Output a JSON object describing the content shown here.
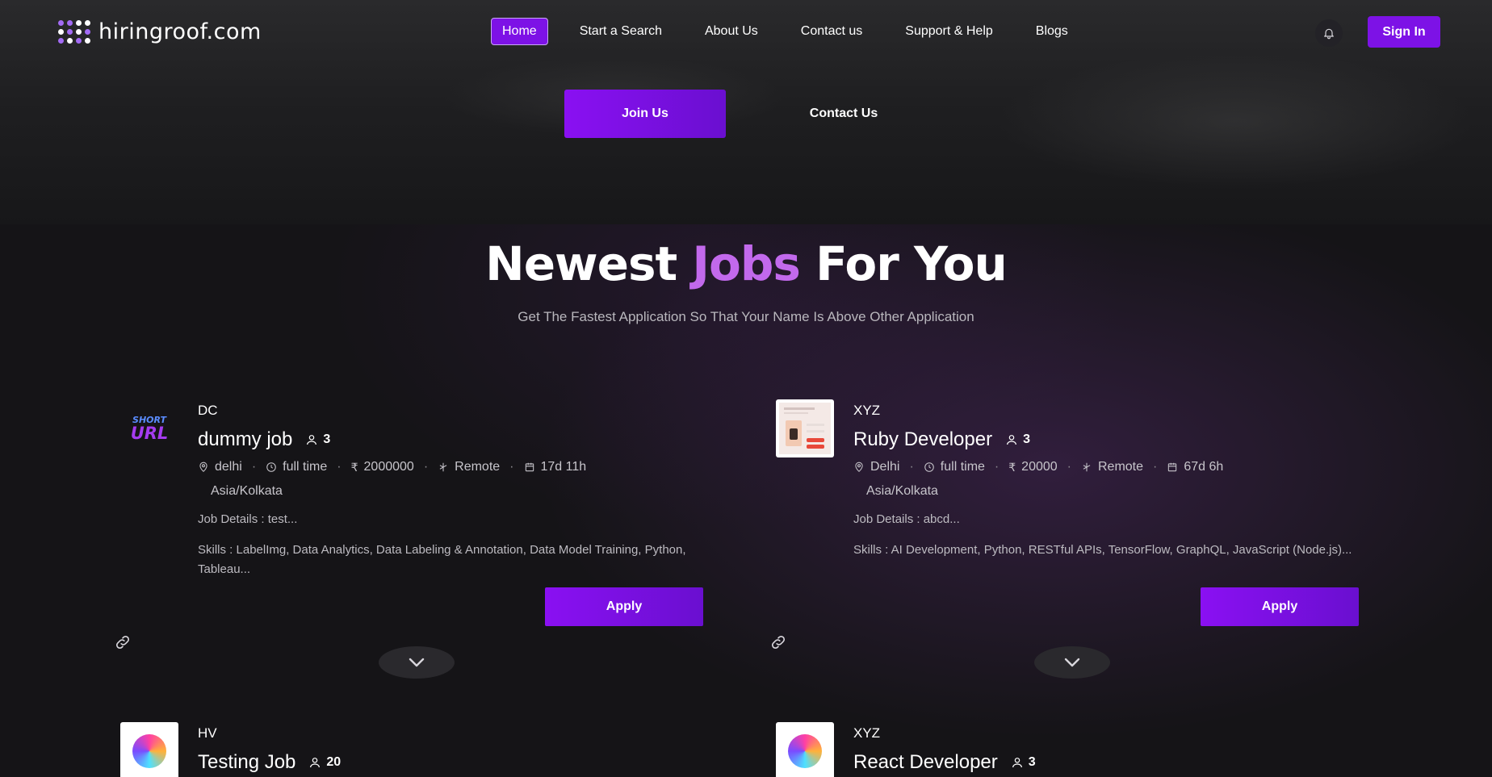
{
  "navbar": {
    "logo_text": "hiringroof.com",
    "items": [
      {
        "label": "Home",
        "active": true
      },
      {
        "label": "Start a Search",
        "active": false
      },
      {
        "label": "About Us",
        "active": false
      },
      {
        "label": "Contact us",
        "active": false
      },
      {
        "label": "Support & Help",
        "active": false
      },
      {
        "label": "Blogs",
        "active": false
      }
    ],
    "bell_icon": "bell-icon",
    "signin_label": "Sign In"
  },
  "hero": {
    "join_label": "Join Us",
    "contact_label": "Contact Us"
  },
  "section": {
    "title_part1": "Newest ",
    "title_accent": "Jobs",
    "title_part2": " For You",
    "subtitle": "Get The Fastest Application So That Your Name Is Above Other Application"
  },
  "colors": {
    "accent": "#7d12e6",
    "title_accent": "#c269ec",
    "background": "#151417"
  },
  "jobs": [
    {
      "company": "DC",
      "logo_text_top": "SHORT",
      "logo_text_bottom": "URL",
      "title": "dummy job",
      "openings": "3",
      "location": "delhi",
      "type": "full time",
      "salary": "2000000",
      "mode": "Remote",
      "posted": "17d 11h",
      "timezone": "Asia/Kolkata",
      "details": "Job Details : test...",
      "skills": "Skills : LabelImg, Data Analytics, Data Labeling & Annotation, Data Model Training, Python, Tableau...",
      "apply_label": "Apply"
    },
    {
      "company": "XYZ",
      "title": "Ruby Developer",
      "openings": "3",
      "location": "Delhi",
      "type": "full time",
      "salary": "20000",
      "mode": "Remote",
      "posted": "67d 6h",
      "timezone": "Asia/Kolkata",
      "details": "Job Details : abcd...",
      "skills": "Skills : AI Development, Python, RESTful APIs, TensorFlow, GraphQL, JavaScript (Node.js)...",
      "apply_label": "Apply"
    },
    {
      "company": "HV",
      "title": "Testing Job",
      "openings": "20"
    },
    {
      "company": "XYZ",
      "title": "React Developer",
      "openings": "3"
    }
  ]
}
